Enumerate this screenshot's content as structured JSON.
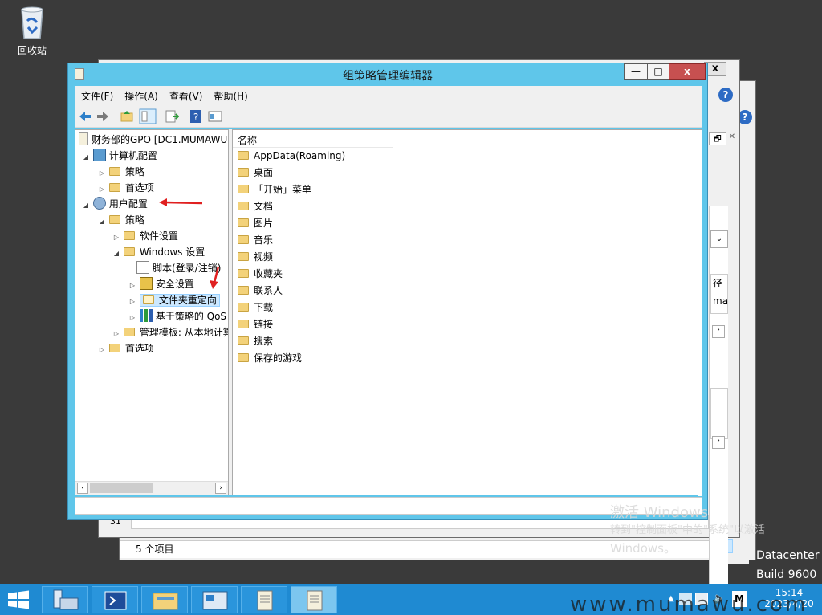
{
  "desktop": {
    "recycle_bin_label": "回收站"
  },
  "background_windows": {
    "close_label": "x",
    "help_label": "?",
    "partial_text_1": "径",
    "partial_text_2": "ma",
    "line_number": "31",
    "item_count": "5 个项目",
    "datacenter": "Datacenter",
    "build": "Build 9600"
  },
  "window": {
    "title": "组策略管理编辑器",
    "minimize": "—",
    "maximize": "□",
    "close": "x"
  },
  "menu": {
    "items": [
      "文件(F)",
      "操作(A)",
      "查看(V)",
      "帮助(H)"
    ]
  },
  "tree": {
    "root": "财务部的GPO [DC1.MUMAWU",
    "computer_config": "计算机配置",
    "cc_policies": "策略",
    "cc_preferences": "首选项",
    "user_config": "用户配置",
    "uc_policies": "策略",
    "software_settings": "软件设置",
    "windows_settings": "Windows 设置",
    "scripts": "脚本(登录/注销)",
    "security_settings": "安全设置",
    "folder_redirection": "文件夹重定向",
    "qos": "基于策略的 QoS",
    "admin_templates": "管理模板: 从本地计算机",
    "uc_preferences": "首选项"
  },
  "list": {
    "column_name": "名称",
    "items": [
      "AppData(Roaming)",
      "桌面",
      "「开始」菜单",
      "文档",
      "图片",
      "音乐",
      "视频",
      "收藏夹",
      "联系人",
      "下载",
      "链接",
      "搜索",
      "保存的游戏"
    ]
  },
  "watermark": {
    "line1": "激活 Windows",
    "line2": "转到\"控制面板\"中的\"系统\"以激活",
    "line3": "Windows。"
  },
  "taskbar": {
    "time": "15:14",
    "date": "2023/4/20",
    "ime": "M"
  },
  "site_watermark": "www.mumawu.com",
  "colors": {
    "title_bar": "#5fc6ea",
    "taskbar": "#1f8ad2",
    "desktop": "#3a3a3a",
    "annotation_arrow": "#e02020"
  }
}
